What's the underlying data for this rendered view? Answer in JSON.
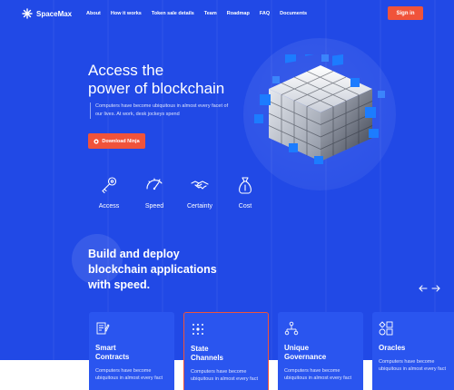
{
  "header": {
    "logo_text": "SpaceMax",
    "nav": [
      "About",
      "How it works",
      "Token sale details",
      "Team",
      "Roadmap",
      "FAQ",
      "Documents"
    ],
    "signin_label": "Sign in"
  },
  "hero": {
    "title_line1": "Access the",
    "title_line2": "power of blockchain",
    "description": "Computers have become ubiquitous in almost every facet of our lives. At work, desk jockeys spend",
    "download_label": "Download Ninja"
  },
  "features": [
    {
      "label": "Access",
      "icon": "key-icon"
    },
    {
      "label": "Speed",
      "icon": "speedometer-icon"
    },
    {
      "label": "Certainty",
      "icon": "handshake-icon"
    },
    {
      "label": "Cost",
      "icon": "money-bag-icon"
    }
  ],
  "section": {
    "title_line1": "Build and deploy",
    "title_line2": "blockchain applications",
    "title_line3": "with speed."
  },
  "cards": [
    {
      "title_line1": "Smart",
      "title_line2": "Contracts",
      "desc_line1": "Computers have become",
      "desc_line2": "ubiquitous in almost every fact",
      "icon": "contract-icon"
    },
    {
      "title_line1": "State",
      "title_line2": "Channels",
      "desc_line1": "Computers have become",
      "desc_line2": "ubiquitous in almost every fact",
      "icon": "channels-grid-icon"
    },
    {
      "title_line1": "Unique",
      "title_line2": "Governance",
      "desc_line1": "Computers have become",
      "desc_line2": "ubiquitous in almost every fact",
      "icon": "governance-icon"
    },
    {
      "title_line1": "Oracles",
      "title_line2": "",
      "desc_line1": "Computers have become",
      "desc_line2": "ubiquitous in almost every fact",
      "icon": "oracles-icon"
    }
  ],
  "colors": {
    "background": "#2149e6",
    "accent": "#f0533a",
    "card": "#2a55ef"
  }
}
